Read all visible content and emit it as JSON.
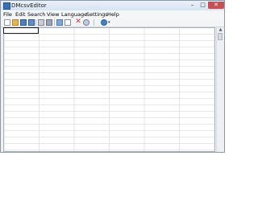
{
  "window": {
    "title": "DMcsvEditor"
  },
  "menu": [
    "File",
    "Edit",
    "Search",
    "View",
    "Language",
    "Settings",
    "Help"
  ],
  "window_controls": {
    "minimize": "–",
    "maximize": "□",
    "close": "✕"
  },
  "toolbar": {
    "buttons": [
      "new-file",
      "open-folder",
      "save",
      "save-all",
      "print",
      "filter",
      "edit",
      "copy",
      "delete",
      "find",
      "language-globe"
    ],
    "delete_glyph": "✕",
    "globe_arrow": "▾"
  },
  "grid": {
    "visible_columns": 6,
    "cells": []
  },
  "scrollbar": {
    "up_glyph": "▲"
  }
}
